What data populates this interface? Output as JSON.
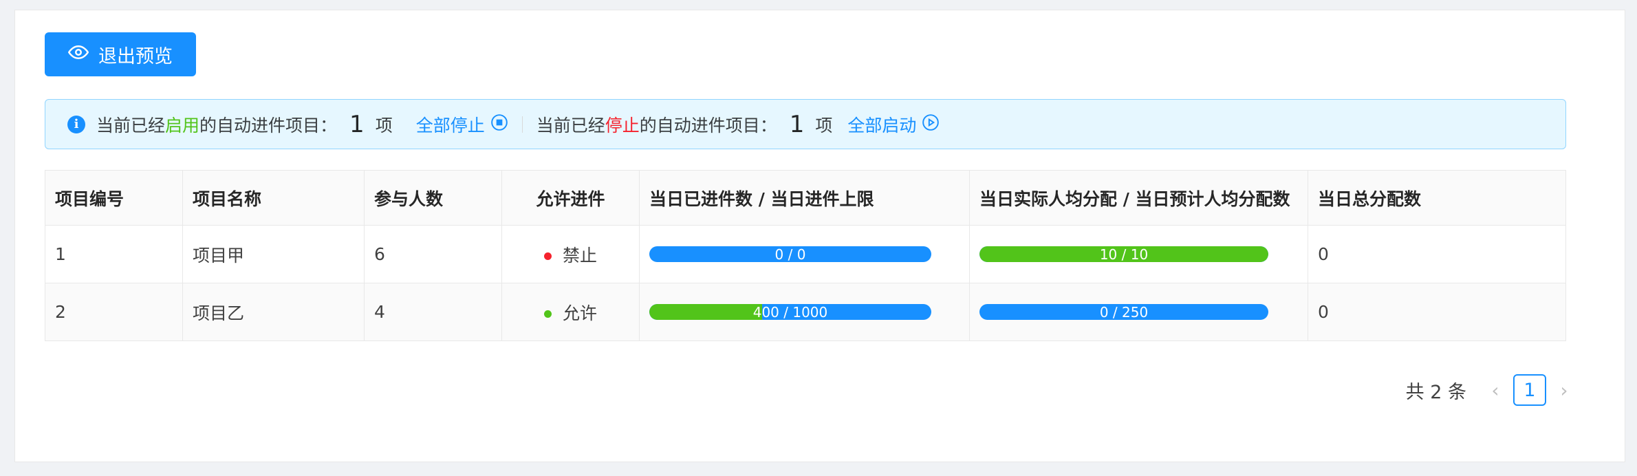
{
  "toolbar": {
    "exit_preview_label": "退出预览"
  },
  "alert": {
    "enabled_prefix": "当前已经",
    "enabled_word": "启用",
    "enabled_suffix": "的自动进件项目：",
    "enabled_count": "1",
    "unit": "项",
    "stop_all_label": "全部停止",
    "stopped_prefix": "当前已经",
    "stopped_word": "停止",
    "stopped_suffix": "的自动进件项目：",
    "stopped_count": "1",
    "start_all_label": "全部启动"
  },
  "table": {
    "headers": [
      "项目编号",
      "项目名称",
      "参与人数",
      "允许进件",
      "当日已进件数 / 当日进件上限",
      "当日实际人均分配 / 当日预计人均分配数",
      "当日总分配数"
    ],
    "rows": [
      {
        "id": "1",
        "name": "项目甲",
        "participants": "6",
        "status_label": "禁止",
        "status_color": "#f5222d",
        "intake_label": "0 / 0",
        "intake_ratio": 0,
        "alloc_label": "10 / 10",
        "alloc_ratio": 1,
        "total": "0"
      },
      {
        "id": "2",
        "name": "项目乙",
        "participants": "4",
        "status_label": "允许",
        "status_color": "#52c41a",
        "intake_label": "400 / 1000",
        "intake_ratio": 0.4,
        "alloc_label": "0 / 250",
        "alloc_ratio": 0,
        "total": "0"
      }
    ]
  },
  "pagination": {
    "total_text": "共 2 条",
    "current_page": "1",
    "prev_icon": "chevron-left-icon",
    "next_icon": "chevron-right-icon"
  },
  "colors": {
    "primary": "#1890ff",
    "success": "#52c41a",
    "danger": "#f5222d"
  }
}
